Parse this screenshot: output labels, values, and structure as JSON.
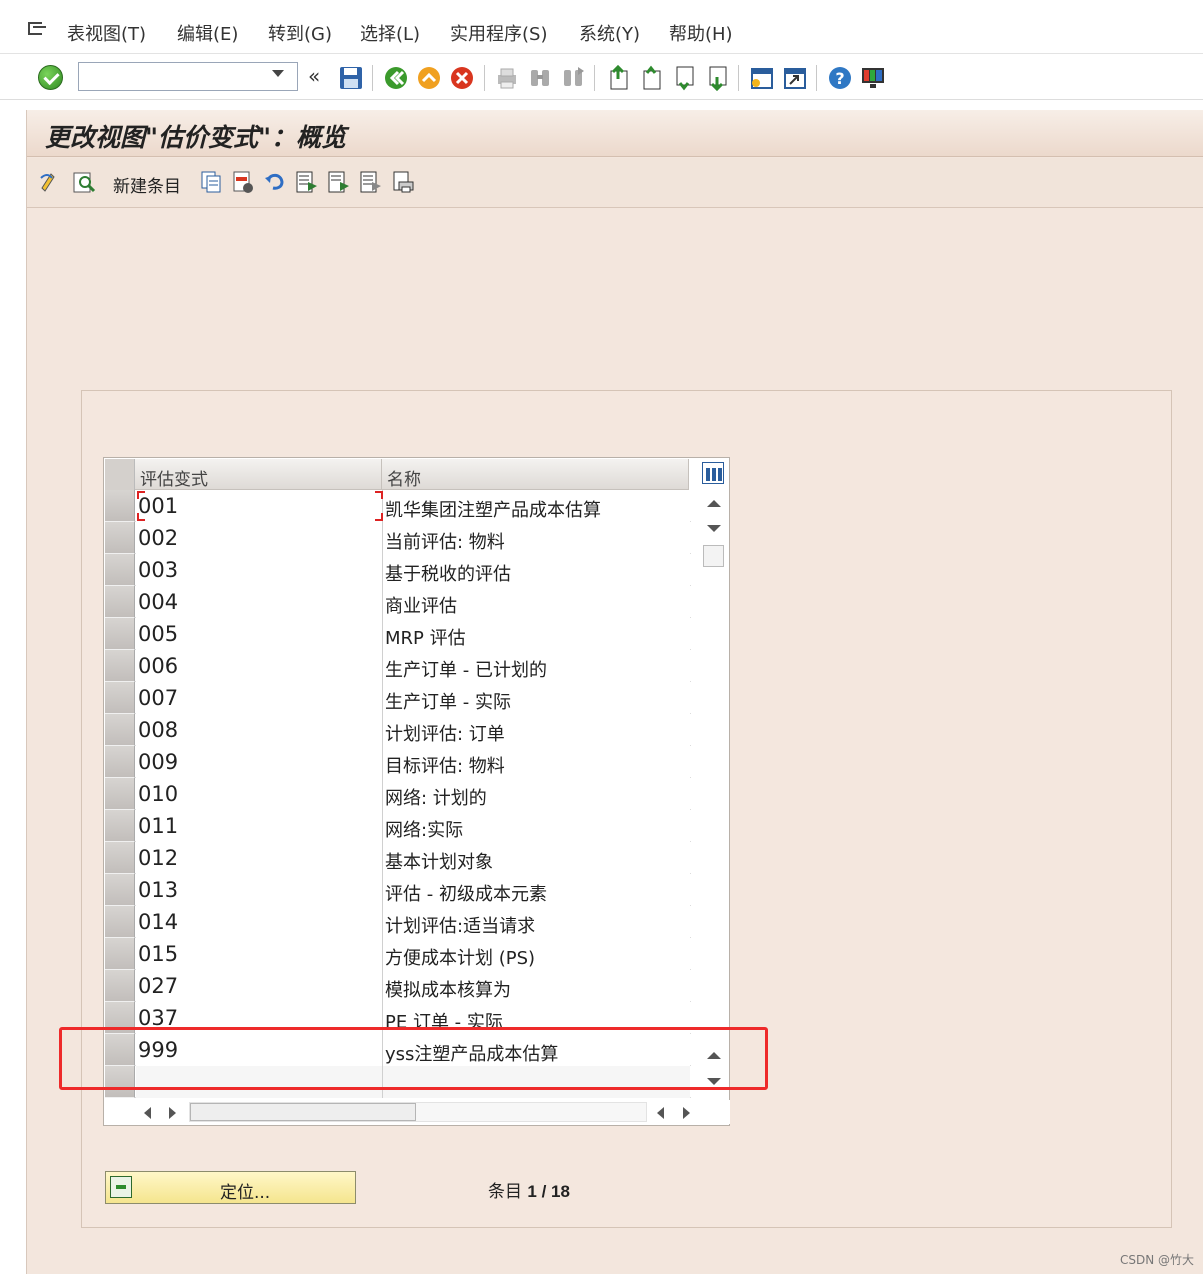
{
  "menu": {
    "items": [
      "表视图(T)",
      "编辑(E)",
      "转到(G)",
      "选择(L)",
      "实用程序(S)",
      "系统(Y)",
      "帮助(H)"
    ]
  },
  "toolbar": {
    "command_field_value": "",
    "icons": [
      "enter-icon",
      "save-icon",
      "back-icon",
      "exit-icon",
      "cancel-icon",
      "print-icon",
      "find-icon",
      "find-next-icon",
      "first-page-icon",
      "previous-page-icon",
      "next-page-icon",
      "last-page-icon",
      "create-session-icon",
      "shortcut-icon",
      "help-icon",
      "customize-layout-icon"
    ]
  },
  "screen": {
    "title": "更改视图\"估价变式\"：概览",
    "new_entries_label": "新建条目"
  },
  "table": {
    "columns": [
      "评估变式",
      "名称"
    ],
    "rows": [
      {
        "code": "001",
        "name": "凯华集团注塑产品成本估算"
      },
      {
        "code": "002",
        "name": "当前评估: 物料"
      },
      {
        "code": "003",
        "name": "基于税收的评估"
      },
      {
        "code": "004",
        "name": "商业评估"
      },
      {
        "code": "005",
        "name": "MRP 评估"
      },
      {
        "code": "006",
        "name": "生产订单 - 已计划的"
      },
      {
        "code": "007",
        "name": "生产订单 - 实际"
      },
      {
        "code": "008",
        "name": "计划评估: 订单"
      },
      {
        "code": "009",
        "name": "目标评估: 物料"
      },
      {
        "code": "010",
        "name": "网络: 计划的"
      },
      {
        "code": "011",
        "name": "网络:实际"
      },
      {
        "code": "012",
        "name": "基本计划对象"
      },
      {
        "code": "013",
        "name": "评估 - 初级成本元素"
      },
      {
        "code": "014",
        "name": "计划评估:适当请求"
      },
      {
        "code": "015",
        "name": "方便成本计划 (PS)"
      },
      {
        "code": "027",
        "name": "模拟成本核算为"
      },
      {
        "code": "037",
        "name": "PE 订单 - 实际"
      },
      {
        "code": "999",
        "name": "yss注塑产品成本估算"
      },
      {
        "code": "",
        "name": ""
      }
    ]
  },
  "footer": {
    "position_button": "定位...",
    "entry_label": "条目",
    "entry_count": "1 / 18"
  },
  "colors": {
    "background": "#f3e6dd",
    "highlight": "#ee2a2a",
    "position_button": "#f5e58e"
  },
  "watermark": "CSDN @竹大"
}
